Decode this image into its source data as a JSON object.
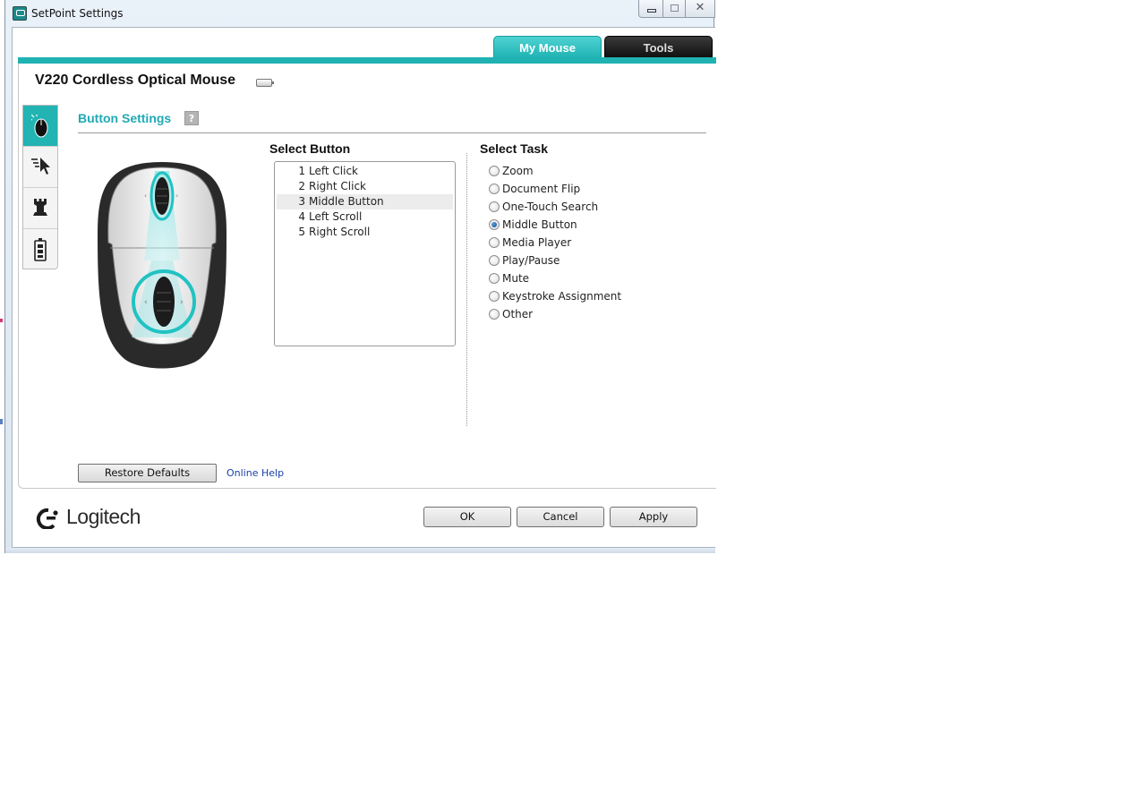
{
  "window": {
    "title": "SetPoint Settings",
    "close_glyph": "✕"
  },
  "tabs": [
    {
      "label": "My Mouse",
      "active": true,
      "color": "#20b2b2"
    },
    {
      "label": "Tools",
      "active": false,
      "color": "#111111"
    }
  ],
  "device": {
    "name": "V220 Cordless Optical Mouse",
    "battery_icon": "battery-icon"
  },
  "sidebar": {
    "items": [
      {
        "name": "mouse-buttons-icon",
        "active": true
      },
      {
        "name": "pointer-icon",
        "active": false
      },
      {
        "name": "game-rook-icon",
        "active": false
      },
      {
        "name": "battery-icon",
        "active": false
      }
    ]
  },
  "section": {
    "title": "Button Settings",
    "help_glyph": "?"
  },
  "select_button": {
    "label": "Select Button",
    "items": [
      {
        "num": "1",
        "label": "Left Click",
        "selected": false
      },
      {
        "num": "2",
        "label": "Right Click",
        "selected": false
      },
      {
        "num": "3",
        "label": "Middle Button",
        "selected": true
      },
      {
        "num": "4",
        "label": "Left Scroll",
        "selected": false
      },
      {
        "num": "5",
        "label": "Right Scroll",
        "selected": false
      }
    ]
  },
  "select_task": {
    "label": "Select Task",
    "options": [
      {
        "label": "Zoom",
        "checked": false
      },
      {
        "label": "Document Flip",
        "checked": false
      },
      {
        "label": "One-Touch Search",
        "checked": false
      },
      {
        "label": "Middle Button",
        "checked": true
      },
      {
        "label": "Media Player",
        "checked": false
      },
      {
        "label": "Play/Pause",
        "checked": false
      },
      {
        "label": "Mute",
        "checked": false
      },
      {
        "label": "Keystroke Assignment",
        "checked": false
      },
      {
        "label": "Other",
        "checked": false
      }
    ]
  },
  "actions": {
    "restore_defaults": "Restore Defaults",
    "online_help": "Online Help",
    "ok": "OK",
    "cancel": "Cancel",
    "apply": "Apply"
  },
  "brand": {
    "logo_text": "Logitech",
    "accent": "#20b2b2",
    "title_accent": "#20a9b4"
  }
}
